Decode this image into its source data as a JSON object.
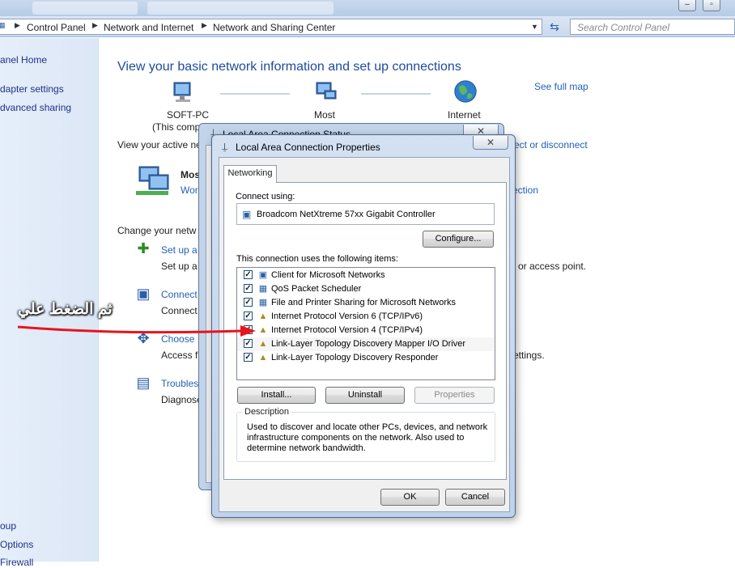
{
  "breadcrumb": [
    "Control Panel",
    "Network and Internet",
    "Network and Sharing Center"
  ],
  "search": {
    "placeholder": "Search Control Panel"
  },
  "leftpane": {
    "items": [
      "anel Home",
      "dapter settings",
      "dvanced sharing",
      "oup",
      "Options",
      "Firewall"
    ]
  },
  "main": {
    "title": "View your basic network information and set up connections",
    "see_full_map": "See full map",
    "node_pc": "SOFT-PC",
    "node_pc_sub": "(This comp",
    "node_mid": "Most",
    "node_internet": "Internet",
    "active_networks": "View your active ne",
    "connect_disconnect": "ect or disconnect",
    "network_name": "Mos",
    "network_type": "Wor",
    "connection_link": "ection",
    "change_heading": "Change your netw",
    "tasks": [
      {
        "link": "Set up a",
        "desc": "Set up a",
        "tail": "or access point."
      },
      {
        "link": "Connect",
        "desc": "Connect"
      },
      {
        "link": "Choose",
        "desc": "Access fi",
        "tail": "ettings."
      },
      {
        "link": "Troubles",
        "desc": "Diagnose"
      }
    ]
  },
  "status_dialog": {
    "title": "Local Area Connection Status"
  },
  "dialog": {
    "title": "Local Area Connection Properties",
    "close": "✕",
    "tab": "Networking",
    "connect_using_label": "Connect using:",
    "adapter": "Broadcom NetXtreme 57xx Gigabit Controller",
    "configure": "Configure...",
    "items_label": "This connection uses the following items:",
    "items": [
      {
        "label": "Client for Microsoft Networks",
        "checked": true,
        "icon": "network-client-icon"
      },
      {
        "label": "QoS Packet Scheduler",
        "checked": true,
        "icon": "network-service-icon"
      },
      {
        "label": "File and Printer Sharing for Microsoft Networks",
        "checked": true,
        "icon": "network-service-icon"
      },
      {
        "label": "Internet Protocol Version 6 (TCP/IPv6)",
        "checked": true,
        "icon": "protocol-icon"
      },
      {
        "label": "Internet Protocol Version 4 (TCP/IPv4)",
        "checked": true,
        "icon": "protocol-icon"
      },
      {
        "label": "Link-Layer Topology Discovery Mapper I/O Driver",
        "checked": true,
        "icon": "protocol-icon"
      },
      {
        "label": "Link-Layer Topology Discovery Responder",
        "checked": true,
        "icon": "protocol-icon"
      }
    ],
    "install": "Install...",
    "uninstall": "Uninstall",
    "properties": "Properties",
    "description_legend": "Description",
    "description": "Used to discover and locate other PCs, devices, and network infrastructure components on the network.  Also used to determine network bandwidth.",
    "ok": "OK",
    "cancel": "Cancel"
  },
  "annotation": {
    "text": "ثم الضغط علي",
    "color": "#e8141b"
  }
}
